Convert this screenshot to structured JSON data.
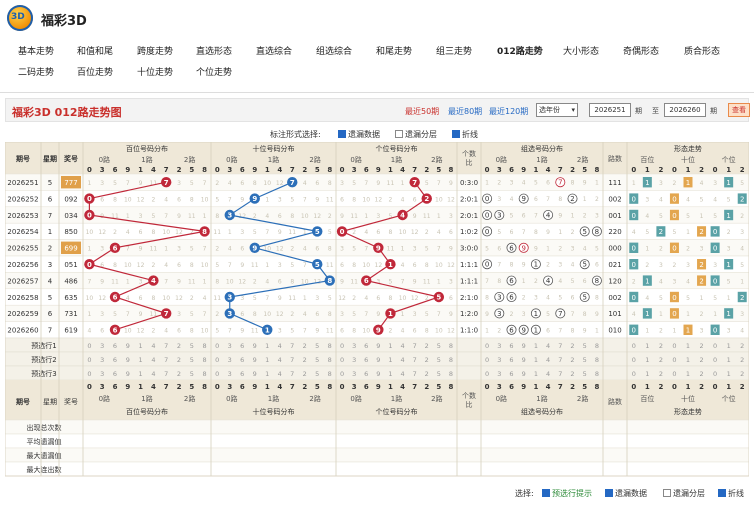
{
  "app": {
    "title": "福彩3D"
  },
  "nav": [
    "基本走势",
    "和值和尾",
    "跨度走势",
    "直选形态",
    "直选综合",
    "组选综合",
    "和尾走势",
    "组三走势",
    "012路走势",
    "大小形态",
    "奇偶形态",
    "质合形态",
    "二码走势",
    "百位走势",
    "十位走势",
    "个位走势"
  ],
  "toolbar": {
    "chart_title": "福彩3D 012路走势图",
    "recent50": "最近50期",
    "recent80": "最近80期",
    "recent120": "最近120期",
    "year_select": "选年份",
    "from_issue": "2026251",
    "to_issue": "2026260",
    "issue_word": "期",
    "to_word": "至",
    "query": "查看"
  },
  "options": {
    "label": "标注形式选择:",
    "missing": "遗漏数据",
    "missing_layer": "遗漏分层",
    "line": "折线"
  },
  "table": {
    "h_issue": "期号",
    "h_week": "星期",
    "h_prize": "奖号",
    "groups": [
      "百位号码分布",
      "十位号码分布",
      "个位号码分布",
      "组选号码分布",
      "形态走势"
    ],
    "h_ratio": "个数比",
    "h_path": "路数",
    "sub012": [
      "0路",
      "1路",
      "2路"
    ],
    "digits": [
      "0",
      "3",
      "6",
      "9",
      "1",
      "4",
      "7",
      "2",
      "5",
      "8"
    ],
    "form_sub": [
      "百位",
      "十位",
      "个位"
    ],
    "form_digits": [
      "0",
      "1",
      "2",
      "0",
      "1",
      "2",
      "0",
      "1",
      "2"
    ],
    "rows": [
      {
        "issue": "2026251",
        "week": "5",
        "prize": "777",
        "ratio": "0:3:0",
        "path": "111"
      },
      {
        "issue": "2026252",
        "week": "6",
        "prize": "092",
        "ratio": "2:0:1",
        "path": "002"
      },
      {
        "issue": "2026253",
        "week": "7",
        "prize": "034",
        "ratio": "2:0:1",
        "path": "001"
      },
      {
        "issue": "2026254",
        "week": "1",
        "prize": "850",
        "ratio": "1:0:2",
        "path": "220"
      },
      {
        "issue": "2026255",
        "week": "2",
        "prize": "699",
        "ratio": "3:0:0",
        "path": "000"
      },
      {
        "issue": "2026256",
        "week": "3",
        "prize": "051",
        "ratio": "1:1:1",
        "path": "021"
      },
      {
        "issue": "2026257",
        "week": "4",
        "prize": "486",
        "ratio": "1:1:1",
        "path": "120"
      },
      {
        "issue": "2026258",
        "week": "5",
        "prize": "635",
        "ratio": "2:1:0",
        "path": "002"
      },
      {
        "issue": "2026259",
        "week": "6",
        "prize": "731",
        "ratio": "1:2:0",
        "path": "101"
      },
      {
        "issue": "2026260",
        "week": "7",
        "prize": "619",
        "ratio": "1:1:0",
        "path": "010"
      }
    ],
    "preview": [
      "预选行1",
      "预选行2",
      "预选行3"
    ],
    "stats": [
      "出现总次数",
      "平均遗漏值",
      "最大遗漏值",
      "最大连出数"
    ]
  },
  "bottom": {
    "label": "选择:",
    "preview": "预选行提示",
    "missing": "遗漏数据",
    "missing_layer": "遗漏分层",
    "line": "折线"
  },
  "colors": {
    "red": "#c0283a",
    "blue": "#2c6fb8",
    "header": "#efe8d8",
    "accent": "#c9302c"
  }
}
